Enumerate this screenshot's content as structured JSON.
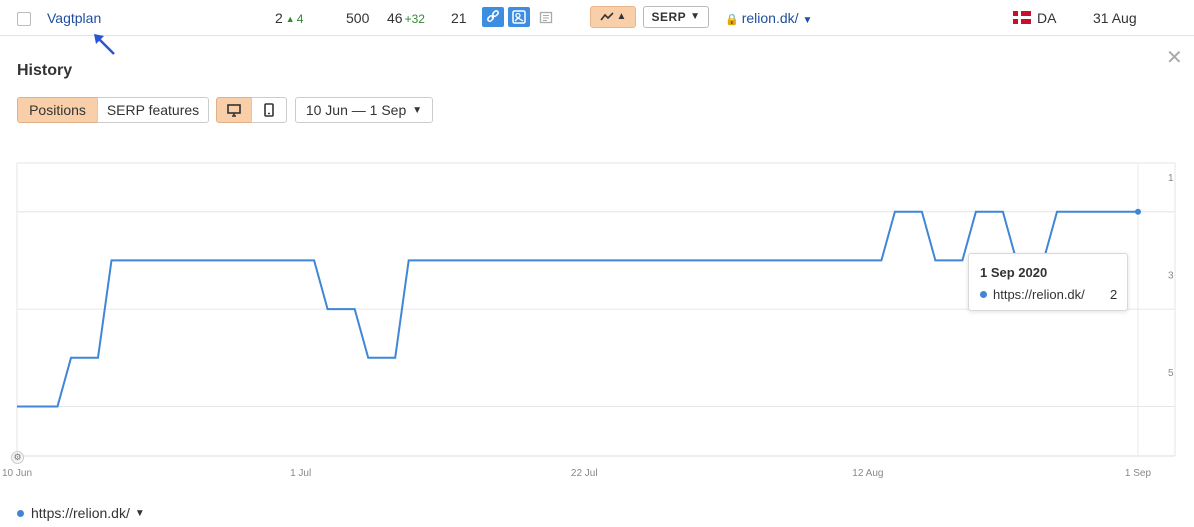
{
  "row": {
    "keyword": "Vagtplan",
    "position": "2",
    "position_change": "4",
    "volume": "500",
    "kd": "46",
    "kd_change": "+32",
    "traffic": "21",
    "serp_label": "SERP",
    "url": "relion.dk/",
    "language": "DA",
    "date": "31 Aug",
    "icons": [
      "link-icon",
      "image-icon",
      "news-icon",
      "trend-icon",
      "lock-icon",
      "denmark-flag-icon"
    ]
  },
  "panel": {
    "title": "History",
    "tabs": [
      "Positions",
      "SERP features"
    ],
    "active_tab": "Positions",
    "device_active": "desktop",
    "date_range": "10 Jun — 1 Sep"
  },
  "tooltip": {
    "date": "1 Sep 2020",
    "url": "https://relion.dk/",
    "value": "2"
  },
  "legend": {
    "series_label": "https://relion.dk/"
  },
  "colors": {
    "series": "#3f86d6",
    "accent": "#f9cfa9",
    "link": "#1f4e9e",
    "positive": "#2e8b2e"
  },
  "chart_data": {
    "type": "line",
    "y_inverted": true,
    "ylim": [
      7,
      1
    ],
    "yticks": [
      "1",
      "3",
      "5"
    ],
    "xticks": [
      "10 Jun",
      "1 Jul",
      "22 Jul",
      "12 Aug",
      "1 Sep"
    ],
    "series": [
      {
        "name": "https://relion.dk/",
        "x": [
          "10 Jun",
          "13 Jun",
          "14 Jun",
          "15 Jun",
          "16 Jun",
          "17 Jun",
          "18 Jun",
          "19 Jun",
          "20 Jun",
          "21 Jun",
          "22 Jun",
          "23 Jun",
          "24 Jun",
          "25 Jun",
          "26 Jun",
          "27 Jun",
          "28 Jun",
          "29 Jun",
          "30 Jun",
          "1 Jul",
          "2 Jul",
          "3 Jul",
          "4 Jul",
          "5 Jul",
          "6 Jul",
          "7 Jul",
          "8 Jul",
          "9 Jul",
          "10 Jul",
          "11 Jul",
          "12 Jul",
          "13 Jul",
          "14 Jul",
          "15 Jul",
          "16 Jul",
          "17 Jul",
          "18 Jul",
          "19 Jul",
          "20 Jul",
          "21 Jul",
          "22 Jul",
          "23 Jul",
          "24 Jul",
          "25 Jul",
          "26 Jul",
          "27 Jul",
          "28 Jul",
          "29 Jul",
          "30 Jul",
          "31 Jul",
          "1 Aug",
          "2 Aug",
          "3 Aug",
          "4 Aug",
          "5 Aug",
          "6 Aug",
          "7 Aug",
          "8 Aug",
          "9 Aug",
          "10 Aug",
          "11 Aug",
          "12 Aug",
          "13 Aug",
          "14 Aug",
          "15 Aug",
          "16 Aug",
          "17 Aug",
          "18 Aug",
          "19 Aug",
          "20 Aug",
          "21 Aug",
          "22 Aug",
          "23 Aug",
          "24 Aug",
          "25 Aug",
          "26 Aug",
          "27 Aug",
          "28 Aug",
          "29 Aug",
          "30 Aug",
          "31 Aug",
          "1 Sep"
        ],
        "values": [
          6,
          6,
          5,
          5,
          5,
          3,
          3,
          3,
          3,
          3,
          3,
          3,
          3,
          3,
          3,
          3,
          3,
          3,
          3,
          3,
          3,
          4,
          4,
          4,
          5,
          5,
          5,
          3,
          3,
          3,
          3,
          3,
          3,
          3,
          3,
          3,
          3,
          3,
          3,
          3,
          3,
          3,
          3,
          3,
          3,
          3,
          3,
          3,
          3,
          3,
          3,
          3,
          3,
          3,
          3,
          3,
          3,
          3,
          3,
          3,
          3,
          3,
          3,
          2,
          2,
          2,
          3,
          3,
          3,
          2,
          2,
          2,
          3,
          3,
          3,
          2,
          2,
          2,
          2,
          2,
          2,
          2
        ]
      }
    ]
  }
}
